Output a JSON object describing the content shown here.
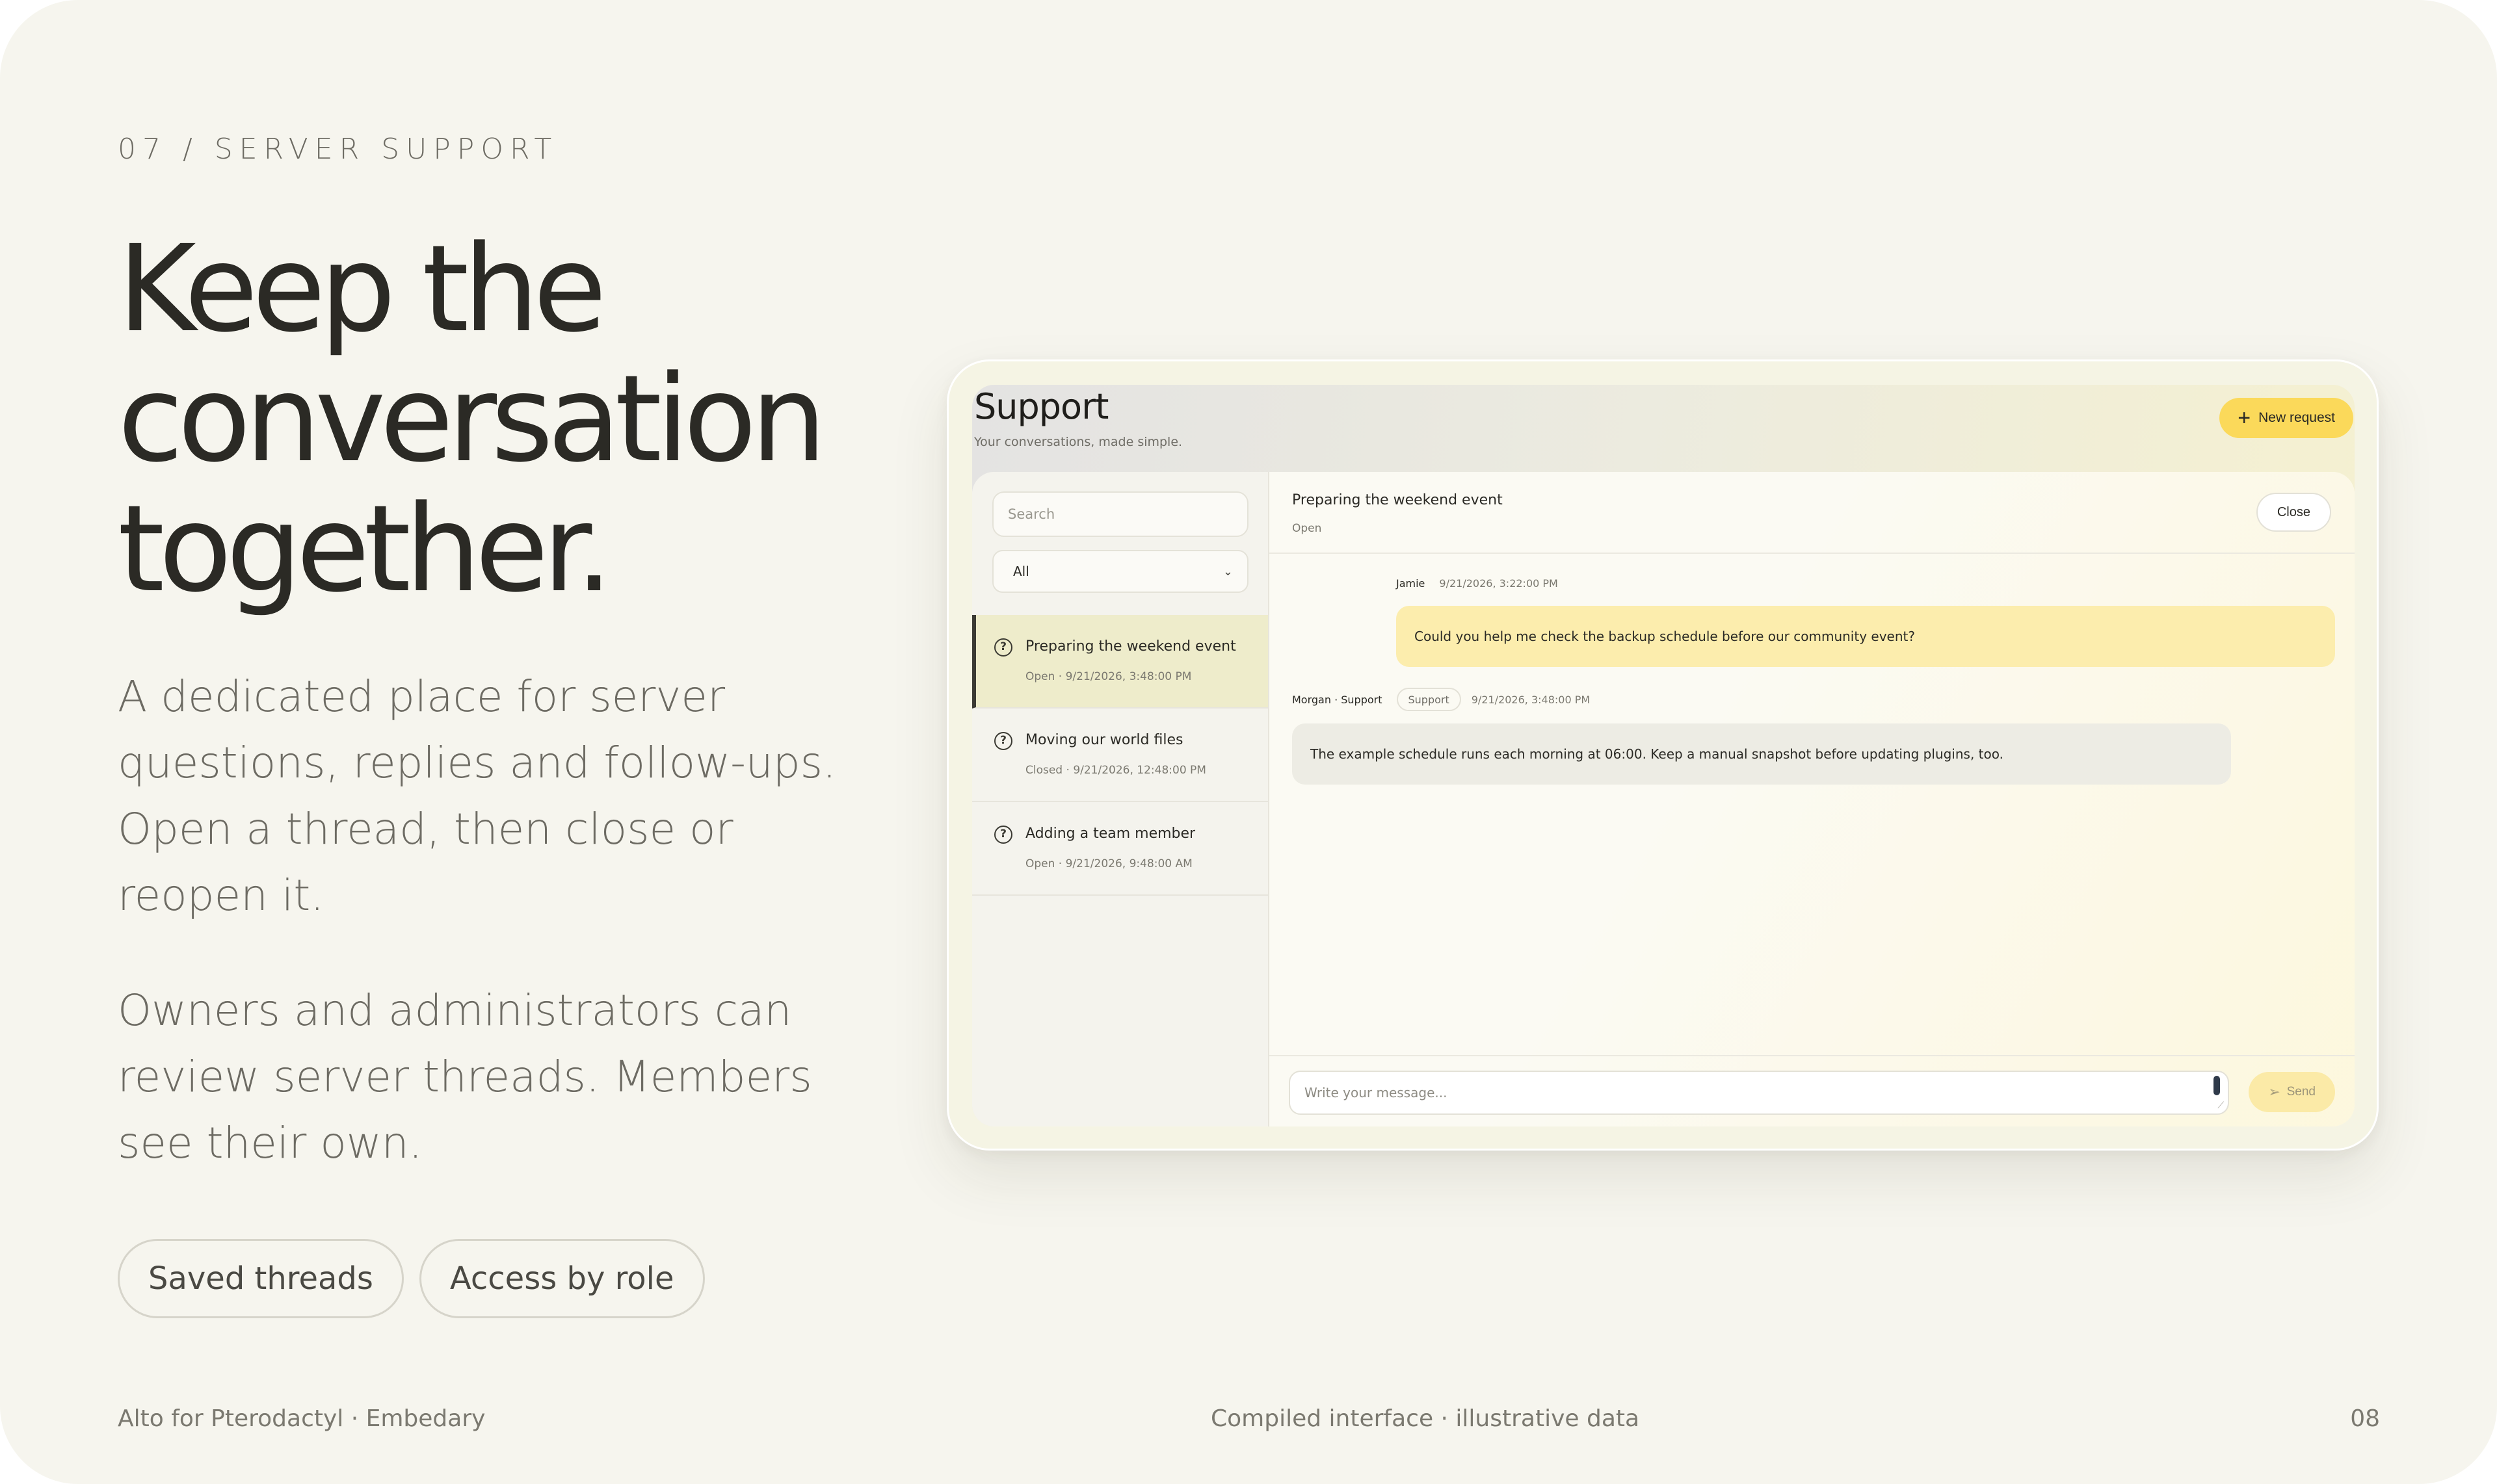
{
  "slide": {
    "eyebrow": "07 / SERVER SUPPORT",
    "headline": [
      "Keep the",
      "conversation",
      "together."
    ],
    "paragraph_1": "A dedicated place for server questions, replies and follow-ups. Open a thread, then close or reopen it.",
    "paragraph_2": "Owners and administrators can review server threads. Members see their own.",
    "chips": [
      "Saved threads",
      "Access by role"
    ],
    "footer": {
      "left": "Alto for Pterodactyl · Embedary",
      "center": "Compiled interface · illustrative data",
      "right": "08"
    }
  },
  "app": {
    "title": "Support",
    "subtitle": "Your conversations, made simple.",
    "new_request_label": "New request",
    "search_placeholder": "Search",
    "filter_value": "All",
    "threads": [
      {
        "title": "Preparing the weekend event",
        "meta": "Open · 9/21/2026, 3:48:00 PM",
        "active": true
      },
      {
        "title": "Moving our world files",
        "meta": "Closed · 9/21/2026, 12:48:00 PM",
        "active": false
      },
      {
        "title": "Adding a team member",
        "meta": "Open · 9/21/2026, 9:48:00 AM",
        "active": false
      }
    ],
    "conversation": {
      "title": "Preparing the weekend event",
      "status": "Open",
      "close_label": "Close",
      "messages": [
        {
          "author": "Jamie",
          "role": "",
          "time": "9/21/2026, 3:22:00 PM",
          "text": "Could you help me check the backup schedule before our community event?"
        },
        {
          "author": "Morgan · Support",
          "role": "Support",
          "time": "9/21/2026, 3:48:00 PM",
          "text": "The example schedule runs each morning at 06:00. Keep a manual snapshot before updating plugins, too."
        }
      ],
      "composer_placeholder": "Write your message...",
      "send_label": "Send"
    }
  },
  "colors": {
    "background": "#f6f5ee",
    "accent": "#fbd95a",
    "user_bubble": "#fcedad",
    "support_bubble": "#edece4",
    "active_thread": "#eeeccb"
  },
  "icons": {
    "new_request": "plus-icon",
    "thread": "question-circle-icon",
    "filter": "chevron-down-icon",
    "send": "send-icon"
  }
}
